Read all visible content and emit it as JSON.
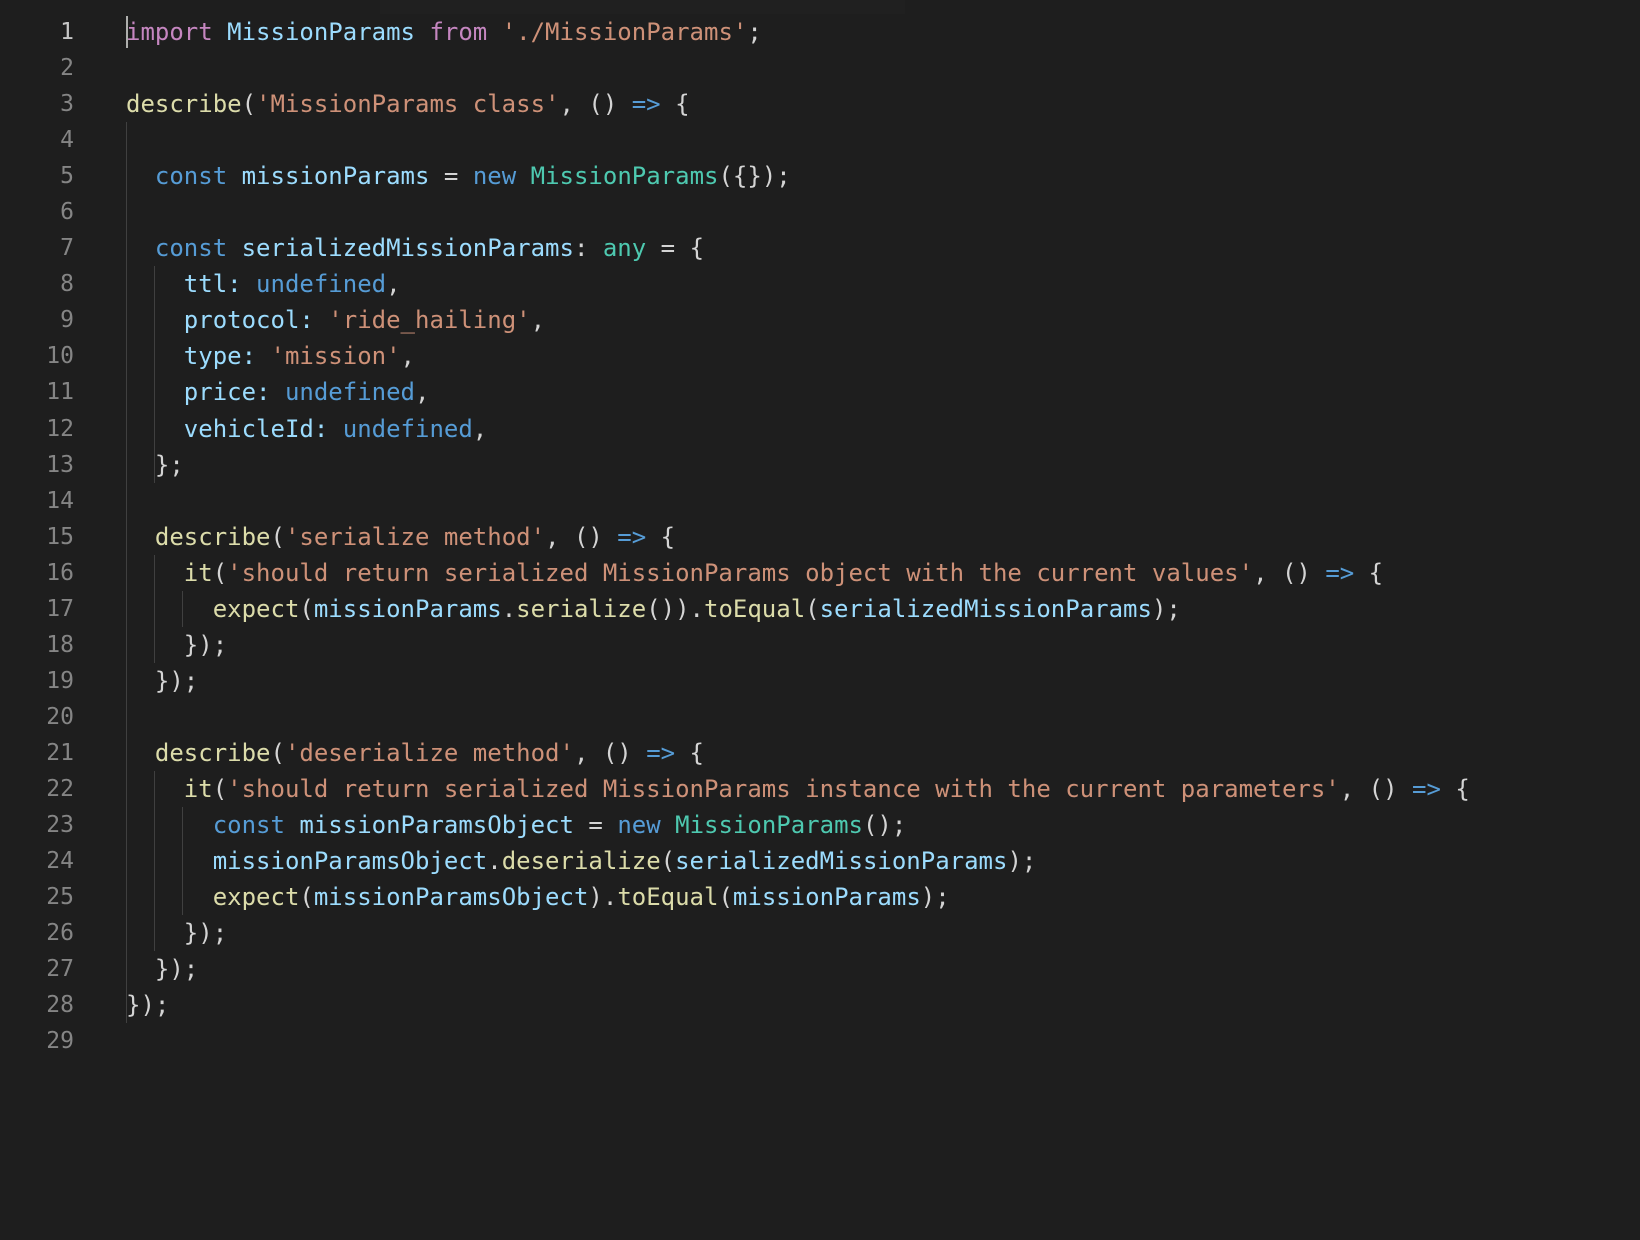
{
  "editor": {
    "cursor_line": 1,
    "lines": [
      {
        "number": "1",
        "tokens": [
          {
            "t": "import",
            "c": "keyword"
          },
          {
            "t": " "
          },
          {
            "t": "MissionParams",
            "c": "variable"
          },
          {
            "t": " "
          },
          {
            "t": "from",
            "c": "keyword"
          },
          {
            "t": " "
          },
          {
            "t": "'./MissionParams'",
            "c": "string"
          },
          {
            "t": ";"
          }
        ]
      },
      {
        "number": "2",
        "tokens": []
      },
      {
        "number": "3",
        "tokens": [
          {
            "t": "describe",
            "c": "function"
          },
          {
            "t": "("
          },
          {
            "t": "'MissionParams class'",
            "c": "string"
          },
          {
            "t": ", () "
          },
          {
            "t": "=>",
            "c": "storage"
          },
          {
            "t": " {"
          }
        ]
      },
      {
        "number": "4",
        "tokens": []
      },
      {
        "number": "5",
        "tokens": [
          {
            "t": "  "
          },
          {
            "t": "const",
            "c": "storage"
          },
          {
            "t": " "
          },
          {
            "t": "missionParams",
            "c": "variable"
          },
          {
            "t": " = "
          },
          {
            "t": "new",
            "c": "storage"
          },
          {
            "t": " "
          },
          {
            "t": "MissionParams",
            "c": "class"
          },
          {
            "t": "({});"
          }
        ]
      },
      {
        "number": "6",
        "tokens": []
      },
      {
        "number": "7",
        "tokens": [
          {
            "t": "  "
          },
          {
            "t": "const",
            "c": "storage"
          },
          {
            "t": " "
          },
          {
            "t": "serializedMissionParams",
            "c": "variable"
          },
          {
            "t": ": "
          },
          {
            "t": "any",
            "c": "class"
          },
          {
            "t": " = {"
          }
        ]
      },
      {
        "number": "8",
        "tokens": [
          {
            "t": "    "
          },
          {
            "t": "ttl:",
            "c": "variable"
          },
          {
            "t": " "
          },
          {
            "t": "undefined",
            "c": "storage"
          },
          {
            "t": ","
          }
        ]
      },
      {
        "number": "9",
        "tokens": [
          {
            "t": "    "
          },
          {
            "t": "protocol:",
            "c": "variable"
          },
          {
            "t": " "
          },
          {
            "t": "'ride_hailing'",
            "c": "string"
          },
          {
            "t": ","
          }
        ]
      },
      {
        "number": "10",
        "tokens": [
          {
            "t": "    "
          },
          {
            "t": "type:",
            "c": "variable"
          },
          {
            "t": " "
          },
          {
            "t": "'mission'",
            "c": "string"
          },
          {
            "t": ","
          }
        ]
      },
      {
        "number": "11",
        "tokens": [
          {
            "t": "    "
          },
          {
            "t": "price:",
            "c": "variable"
          },
          {
            "t": " "
          },
          {
            "t": "undefined",
            "c": "storage"
          },
          {
            "t": ","
          }
        ]
      },
      {
        "number": "12",
        "tokens": [
          {
            "t": "    "
          },
          {
            "t": "vehicleId:",
            "c": "variable"
          },
          {
            "t": " "
          },
          {
            "t": "undefined",
            "c": "storage"
          },
          {
            "t": ","
          }
        ]
      },
      {
        "number": "13",
        "tokens": [
          {
            "t": "  };"
          }
        ]
      },
      {
        "number": "14",
        "tokens": []
      },
      {
        "number": "15",
        "tokens": [
          {
            "t": "  "
          },
          {
            "t": "describe",
            "c": "function"
          },
          {
            "t": "("
          },
          {
            "t": "'serialize method'",
            "c": "string"
          },
          {
            "t": ", () "
          },
          {
            "t": "=>",
            "c": "storage"
          },
          {
            "t": " {"
          }
        ]
      },
      {
        "number": "16",
        "tokens": [
          {
            "t": "    "
          },
          {
            "t": "it",
            "c": "function"
          },
          {
            "t": "("
          },
          {
            "t": "'should return serialized MissionParams object with the current values'",
            "c": "string"
          },
          {
            "t": ", () "
          },
          {
            "t": "=>",
            "c": "storage"
          },
          {
            "t": " {"
          }
        ]
      },
      {
        "number": "17",
        "tokens": [
          {
            "t": "      "
          },
          {
            "t": "expect",
            "c": "function"
          },
          {
            "t": "("
          },
          {
            "t": "missionParams",
            "c": "variable"
          },
          {
            "t": "."
          },
          {
            "t": "serialize",
            "c": "function"
          },
          {
            "t": "())."
          },
          {
            "t": "toEqual",
            "c": "function"
          },
          {
            "t": "("
          },
          {
            "t": "serializedMissionParams",
            "c": "variable"
          },
          {
            "t": ");"
          }
        ]
      },
      {
        "number": "18",
        "tokens": [
          {
            "t": "    });"
          }
        ]
      },
      {
        "number": "19",
        "tokens": [
          {
            "t": "  });"
          }
        ]
      },
      {
        "number": "20",
        "tokens": []
      },
      {
        "number": "21",
        "tokens": [
          {
            "t": "  "
          },
          {
            "t": "describe",
            "c": "function"
          },
          {
            "t": "("
          },
          {
            "t": "'deserialize method'",
            "c": "string"
          },
          {
            "t": ", () "
          },
          {
            "t": "=>",
            "c": "storage"
          },
          {
            "t": " {"
          }
        ]
      },
      {
        "number": "22",
        "tokens": [
          {
            "t": "    "
          },
          {
            "t": "it",
            "c": "function"
          },
          {
            "t": "("
          },
          {
            "t": "'should return serialized MissionParams instance with the current parameters'",
            "c": "string"
          },
          {
            "t": ", () "
          },
          {
            "t": "=>",
            "c": "storage"
          },
          {
            "t": " {"
          }
        ]
      },
      {
        "number": "23",
        "tokens": [
          {
            "t": "      "
          },
          {
            "t": "const",
            "c": "storage"
          },
          {
            "t": " "
          },
          {
            "t": "missionParamsObject",
            "c": "variable"
          },
          {
            "t": " = "
          },
          {
            "t": "new",
            "c": "storage"
          },
          {
            "t": " "
          },
          {
            "t": "MissionParams",
            "c": "class"
          },
          {
            "t": "();"
          }
        ]
      },
      {
        "number": "24",
        "tokens": [
          {
            "t": "      "
          },
          {
            "t": "missionParamsObject",
            "c": "variable"
          },
          {
            "t": "."
          },
          {
            "t": "deserialize",
            "c": "function"
          },
          {
            "t": "("
          },
          {
            "t": "serializedMissionParams",
            "c": "variable"
          },
          {
            "t": ");"
          }
        ]
      },
      {
        "number": "25",
        "tokens": [
          {
            "t": "      "
          },
          {
            "t": "expect",
            "c": "function"
          },
          {
            "t": "("
          },
          {
            "t": "missionParamsObject",
            "c": "variable"
          },
          {
            "t": ")."
          },
          {
            "t": "toEqual",
            "c": "function"
          },
          {
            "t": "("
          },
          {
            "t": "missionParams",
            "c": "variable"
          },
          {
            "t": ");"
          }
        ]
      },
      {
        "number": "26",
        "tokens": [
          {
            "t": "    });"
          }
        ]
      },
      {
        "number": "27",
        "tokens": [
          {
            "t": "  });"
          }
        ]
      },
      {
        "number": "28",
        "tokens": [
          {
            "t": "});"
          }
        ]
      },
      {
        "number": "29",
        "tokens": []
      }
    ]
  },
  "theme": {
    "background": "#1e1e1e",
    "line_number": "#858585",
    "keyword": "#c586c0",
    "storage": "#569cd6",
    "variable": "#9cdcfe",
    "class": "#4ec9b0",
    "string": "#ce9178",
    "function": "#dcdcaa",
    "punctuation": "#d4d4d4"
  }
}
